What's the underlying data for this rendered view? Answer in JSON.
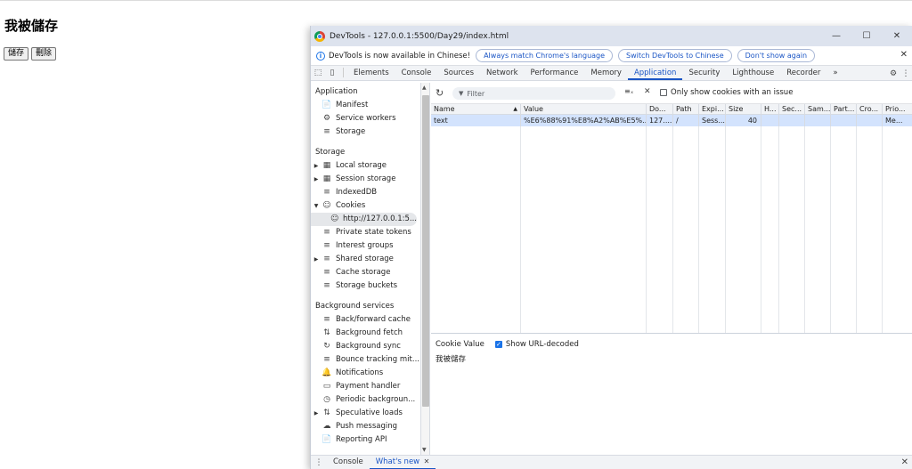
{
  "page": {
    "heading": "我被儲存",
    "buttons": {
      "save": "儲存",
      "delete": "刪除"
    }
  },
  "window": {
    "title": "DevTools - 127.0.0.1:5500/Day29/index.html",
    "controls": {
      "minimize": "—",
      "maximize": "☐",
      "close": "✕"
    }
  },
  "infobar": {
    "message": "DevTools is now available in Chinese!",
    "btn_match": "Always match Chrome's language",
    "btn_switch": "Switch DevTools to Chinese",
    "btn_dont_show": "Don't show again",
    "close": "✕"
  },
  "tabs": [
    "Elements",
    "Console",
    "Sources",
    "Network",
    "Performance",
    "Memory",
    "Application",
    "Security",
    "Lighthouse",
    "Recorder"
  ],
  "tabs_more": "»",
  "tabs_active": "Application",
  "sidebar": {
    "application": {
      "title": "Application",
      "items": [
        {
          "label": "Manifest",
          "icon": "📄"
        },
        {
          "label": "Service workers",
          "icon": "⚙"
        },
        {
          "label": "Storage",
          "icon": "≡"
        }
      ]
    },
    "storage": {
      "title": "Storage",
      "items": [
        {
          "label": "Local storage",
          "icon": "▦",
          "arrow": "▶"
        },
        {
          "label": "Session storage",
          "icon": "▦",
          "arrow": "▶"
        },
        {
          "label": "IndexedDB",
          "icon": "≡",
          "arrow": ""
        },
        {
          "label": "Cookies",
          "icon": "☺",
          "arrow": "▼"
        },
        {
          "label": "http://127.0.0.1:5...",
          "icon": "☺",
          "arrow": ""
        },
        {
          "label": "Private state tokens",
          "icon": "≡",
          "arrow": ""
        },
        {
          "label": "Interest groups",
          "icon": "≡",
          "arrow": ""
        },
        {
          "label": "Shared storage",
          "icon": "≡",
          "arrow": "▶"
        },
        {
          "label": "Cache storage",
          "icon": "≡",
          "arrow": ""
        },
        {
          "label": "Storage buckets",
          "icon": "≡",
          "arrow": ""
        }
      ]
    },
    "background": {
      "title": "Background services",
      "items": [
        {
          "label": "Back/forward cache",
          "icon": "≡",
          "arrow": ""
        },
        {
          "label": "Background fetch",
          "icon": "⇅",
          "arrow": ""
        },
        {
          "label": "Background sync",
          "icon": "↻",
          "arrow": ""
        },
        {
          "label": "Bounce tracking mit...",
          "icon": "≡",
          "arrow": ""
        },
        {
          "label": "Notifications",
          "icon": "🔔",
          "arrow": ""
        },
        {
          "label": "Payment handler",
          "icon": "▭",
          "arrow": ""
        },
        {
          "label": "Periodic backgroun...",
          "icon": "◷",
          "arrow": ""
        },
        {
          "label": "Speculative loads",
          "icon": "⇅",
          "arrow": "▶"
        },
        {
          "label": "Push messaging",
          "icon": "☁",
          "arrow": ""
        },
        {
          "label": "Reporting API",
          "icon": "📄",
          "arrow": ""
        }
      ]
    }
  },
  "toolbar": {
    "filter_placeholder": "Filter",
    "only_issue_label": "Only show cookies with an issue"
  },
  "cookies_table": {
    "columns": [
      "Name",
      "Value",
      "Do...",
      "Path",
      "Expi...",
      "Size",
      "H...",
      "Sec...",
      "Sam...",
      "Part...",
      "Cro...",
      "Prio..."
    ],
    "sort_indicator": "▲",
    "rows": [
      {
        "cells": [
          "text",
          "%E6%88%91%E8%A2%AB%E5%...",
          "127....",
          "/",
          "Sess...",
          "40",
          "",
          "",
          "",
          "",
          "",
          "Me..."
        ]
      }
    ]
  },
  "detail": {
    "label": "Cookie Value",
    "show_decoded_label": "Show URL-decoded",
    "value": "我被儲存"
  },
  "drawer": {
    "tabs": [
      "Console",
      "What's new"
    ],
    "active": "What's new",
    "close": "✕"
  },
  "colors": {
    "accent": "#1a55c5",
    "selected_row": "#d3e3fd",
    "titlebar": "#dde3ee"
  }
}
